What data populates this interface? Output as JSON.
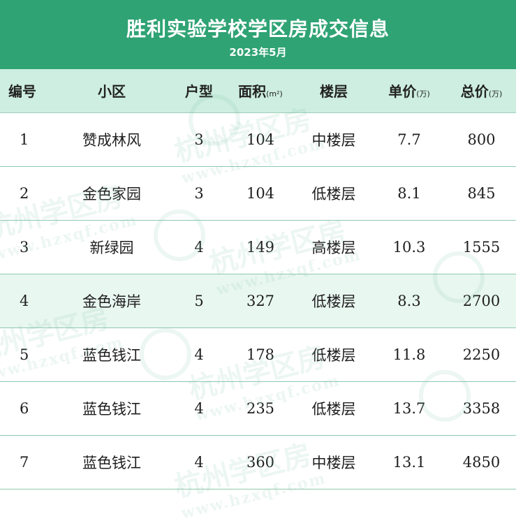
{
  "header": {
    "title": "胜利实验学校学区房成交信息",
    "subtitle": "2023年5月"
  },
  "columns": [
    "编号",
    "小区",
    "户型",
    "面积",
    "楼层",
    "单价",
    "总价"
  ],
  "column_units": {
    "area": "(m²)",
    "unit_price": "(万)",
    "total_price": "(万)"
  },
  "rows": [
    [
      "1",
      "赞成林风",
      "3",
      "104",
      "中楼层",
      "7.7",
      "800"
    ],
    [
      "2",
      "金色家园",
      "3",
      "104",
      "低楼层",
      "8.1",
      "845"
    ],
    [
      "3",
      "新绿园",
      "4",
      "149",
      "高楼层",
      "10.3",
      "1555"
    ],
    [
      "4",
      "金色海岸",
      "5",
      "327",
      "低楼层",
      "8.3",
      "2700"
    ],
    [
      "5",
      "蓝色钱江",
      "4",
      "178",
      "低楼层",
      "11.8",
      "2250"
    ],
    [
      "6",
      "蓝色钱江",
      "4",
      "235",
      "低楼层",
      "13.7",
      "3358"
    ],
    [
      "7",
      "蓝色钱江",
      "4",
      "360",
      "中楼层",
      "13.1",
      "4850"
    ]
  ],
  "watermark": {
    "text": "杭州学区房",
    "url": "www.hzxqf.com"
  },
  "colors": {
    "header_bg": "#2fa374",
    "header_row_bg": "#cdeee0",
    "highlight_row_bg": "#e9f7f1"
  }
}
